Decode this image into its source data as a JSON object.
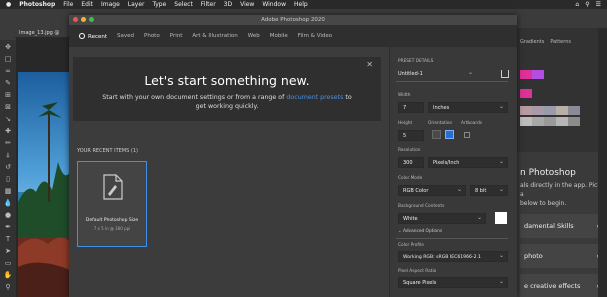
{
  "menubar": {
    "apple": "",
    "items": [
      "Photoshop",
      "File",
      "Edit",
      "Image",
      "Layer",
      "Type",
      "Select",
      "Filter",
      "3D",
      "View",
      "Window",
      "Help"
    ]
  },
  "document_tab": "Image_13.jpg @",
  "dialog": {
    "title": "Adobe Photoshop 2020",
    "tabs": [
      "Recent",
      "Saved",
      "Photo",
      "Print",
      "Art & Illustration",
      "Web",
      "Mobile",
      "Film & Video"
    ],
    "active_tab": "Recent",
    "hero": {
      "title": "Let's start something new.",
      "text_before": "Start with your own document settings or from a range of",
      "link": "document presets",
      "text_after": "to",
      "text_line2": "get working quickly."
    },
    "recent_header": "YOUR RECENT ITEMS  (1)",
    "recent_items": [
      {
        "name": "Default Photoshop Size",
        "size": "7 x 5 in @ 300 ppi"
      }
    ],
    "preset": {
      "section": "PRESET DETAILS",
      "name": "Untitled-1",
      "width_label": "Width",
      "width": "7",
      "width_unit": "Inches",
      "height_label": "Height",
      "height": "5",
      "orientation_label": "Orientation",
      "artboards_label": "Artboards",
      "resolution_label": "Resolution",
      "resolution": "300",
      "resolution_unit": "Pixels/Inch",
      "color_mode_label": "Color Mode",
      "color_mode": "RGB Color",
      "bit_depth": "8 bit",
      "background_label": "Background Contents",
      "background": "White",
      "advanced": "Advanced Options",
      "profile_label": "Color Profile",
      "profile": "Working RGB: sRGB IEC61966-2.1",
      "pixel_aspect_label": "Pixel Aspect Ratio",
      "pixel_aspect": "Square Pixels"
    }
  },
  "right_panel": {
    "tabs": [
      "Gradients",
      "Patterns"
    ],
    "learn_title": "n Photoshop",
    "learn_sub1": "als directly in the app. Pick a",
    "learn_sub2": "below to begin.",
    "cards": [
      "damental Skills",
      "photo",
      "e creative effects"
    ]
  },
  "colors": {
    "accent": "#3f8fe8",
    "link": "#4a8fe0",
    "magenta": "#e0309a",
    "pink": "#e86fb0"
  }
}
